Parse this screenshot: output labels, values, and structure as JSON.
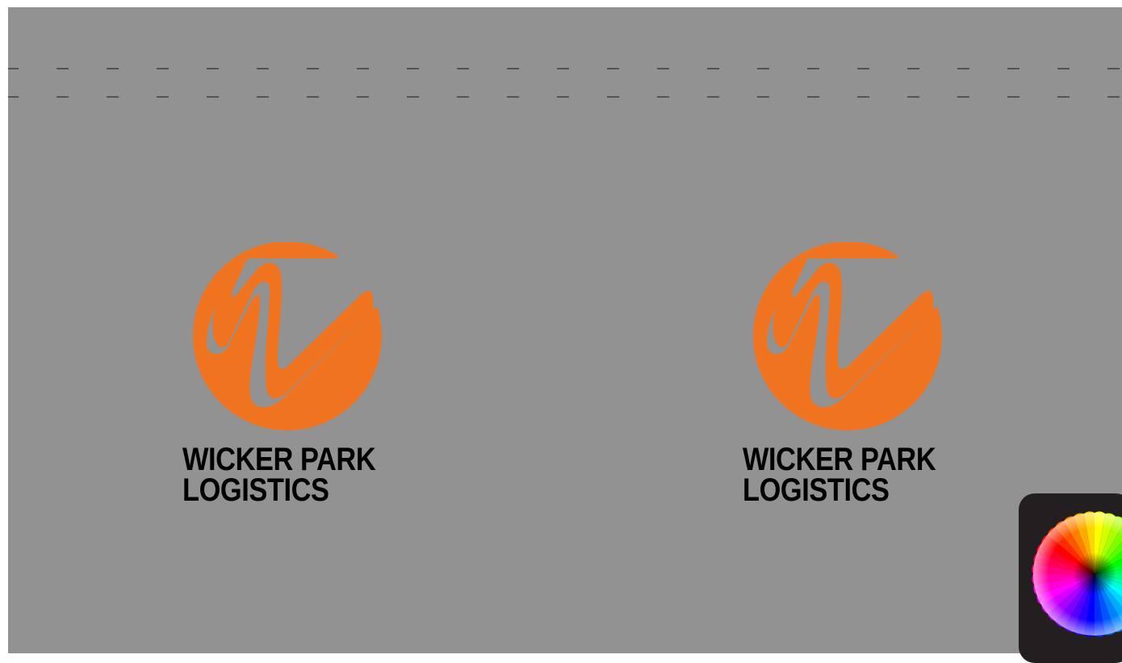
{
  "artboard": {
    "background": "#929292",
    "guide_color": "#ffffff",
    "mark_color": "#f07420"
  },
  "logos": [
    {
      "line1": "WICKER PARK",
      "line2": "LOGISTICS",
      "icon": "wicker-park-w-logo"
    },
    {
      "line1": "WICKER PARK",
      "line2": "LOGISTICS",
      "icon": "wicker-park-w-logo"
    }
  ],
  "widget": {
    "icon": "color-wheel-icon",
    "background": "#231f20"
  }
}
